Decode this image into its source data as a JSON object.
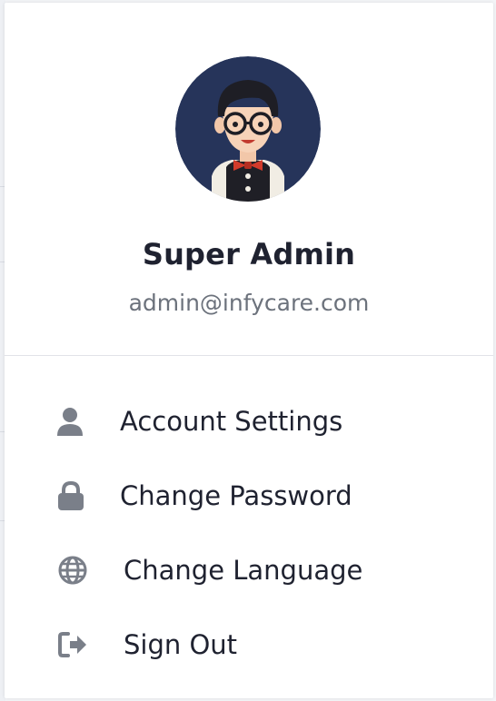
{
  "user": {
    "name": "Super Admin",
    "email": "admin@infycare.com",
    "avatar_bg": "#26345a"
  },
  "menu": {
    "items": [
      {
        "label": "Account Settings",
        "icon": "user-icon"
      },
      {
        "label": "Change Password",
        "icon": "lock-icon"
      },
      {
        "label": "Change Language",
        "icon": "globe-icon"
      },
      {
        "label": "Sign Out",
        "icon": "sign-out-icon"
      }
    ]
  },
  "colors": {
    "icon": "#7a7f89",
    "text": "#1f2230",
    "muted": "#6c727c"
  }
}
